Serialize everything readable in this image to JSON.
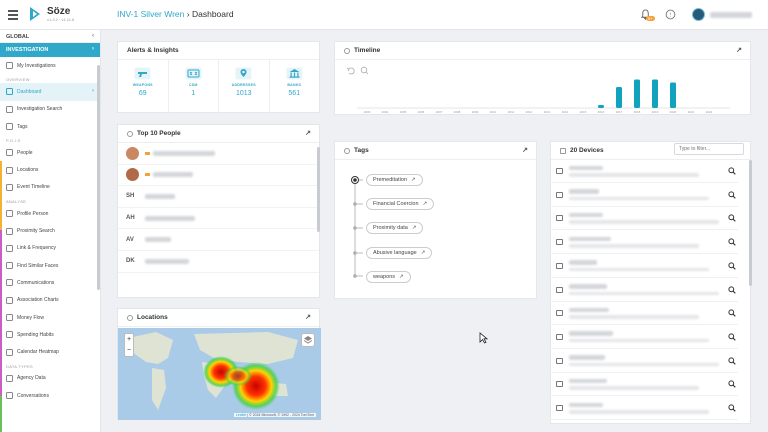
{
  "app": {
    "name": "Söze",
    "version": "v1.3.2 · v1.11.6"
  },
  "breadcrumb": {
    "case": "INV-1 Silver Wren",
    "separator": "›",
    "page": "Dashboard"
  },
  "notifications": {
    "count": "9+"
  },
  "sidebar": {
    "global_label": "GLOBAL",
    "investigation_label": "INVESTIGATION",
    "my_investigations": "My Investigations",
    "sections": {
      "overview": "OVERVIEW",
      "poi": "P.O.I.S",
      "analyse": "ANALYSE",
      "data_types": "DATA TYPES"
    },
    "overview_items": [
      "Dashboard",
      "Investigation Search",
      "Tags"
    ],
    "poi_items": [
      "People",
      "Locations",
      "Event Timeline"
    ],
    "analyse_items": [
      "Profile Person",
      "Proximity Search",
      "Link & Frequency",
      "Find Similar Faces",
      "Communications",
      "Association Charts",
      "Money Flow",
      "Spending Habits",
      "Calendar Heatmap"
    ],
    "data_type_items": [
      "Agency Data",
      "Conversations"
    ]
  },
  "alerts": {
    "title": "Alerts & Insights",
    "items": [
      {
        "label": "WEAPONS",
        "value": "69",
        "icon": "gun-icon"
      },
      {
        "label": "CSM",
        "value": "1",
        "icon": "csm-icon"
      },
      {
        "label": "ADDRESSES",
        "value": "1013",
        "icon": "address-icon"
      },
      {
        "label": "BANKS",
        "value": "561",
        "icon": "bank-icon"
      }
    ]
  },
  "top_people": {
    "title": "Top 10 People",
    "initials": [
      "",
      "",
      "SH",
      "AH",
      "AV",
      "DK"
    ]
  },
  "locations": {
    "title": "Locations",
    "attribution_link": "Leaflet",
    "attribution_text": " | © 2024 Microsoft, © 1992 - 2024 TomTom"
  },
  "timeline": {
    "title": "Timeline",
    "chart_data": {
      "type": "bar",
      "categories": [
        "2003",
        "2004",
        "2005",
        "2006",
        "2007",
        "2008",
        "2009",
        "2010",
        "2011",
        "2012",
        "2013",
        "2014",
        "2015",
        "2016",
        "2017",
        "2018",
        "2019",
        "2020",
        "2021",
        "2022"
      ],
      "values": [
        0,
        0,
        0,
        0,
        0,
        0,
        0,
        0,
        0,
        0,
        0,
        0,
        0,
        10,
        70,
        95,
        95,
        85,
        0,
        0
      ],
      "ylim": [
        0,
        100
      ],
      "color": "#11a3bd"
    }
  },
  "tags": {
    "title": "Tags",
    "items": [
      "Premeditation",
      "Financial Coercion",
      "Proximity data",
      "Abusive language",
      "weapons"
    ]
  },
  "devices": {
    "title": "20 Devices",
    "filter_placeholder": "Type to filter..."
  },
  "colors": {
    "accent": "#2fa8c9",
    "badge": "#f2a33a"
  }
}
